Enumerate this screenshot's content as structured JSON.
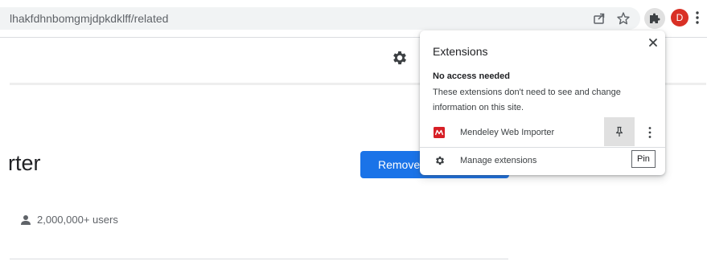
{
  "browser": {
    "url": "lhakfdhnbomgmjdpkdklff/related",
    "avatar_letter": "D",
    "accent_color": "#1a73e8",
    "avatar_color": "#d93025"
  },
  "page": {
    "extension_name_partial": "rter",
    "remove_button_label": "Remove",
    "users_count": "2,000,000+ users"
  },
  "extensions_popup": {
    "title": "Extensions",
    "section_title": "No access needed",
    "section_description": "These extensions don't need to see and change information on this site.",
    "extensions": [
      {
        "name": "Mendeley Web Importer",
        "icon": "mendeley-logo",
        "pinned": false
      }
    ],
    "manage_label": "Manage extensions",
    "pin_tooltip": "Pin"
  }
}
